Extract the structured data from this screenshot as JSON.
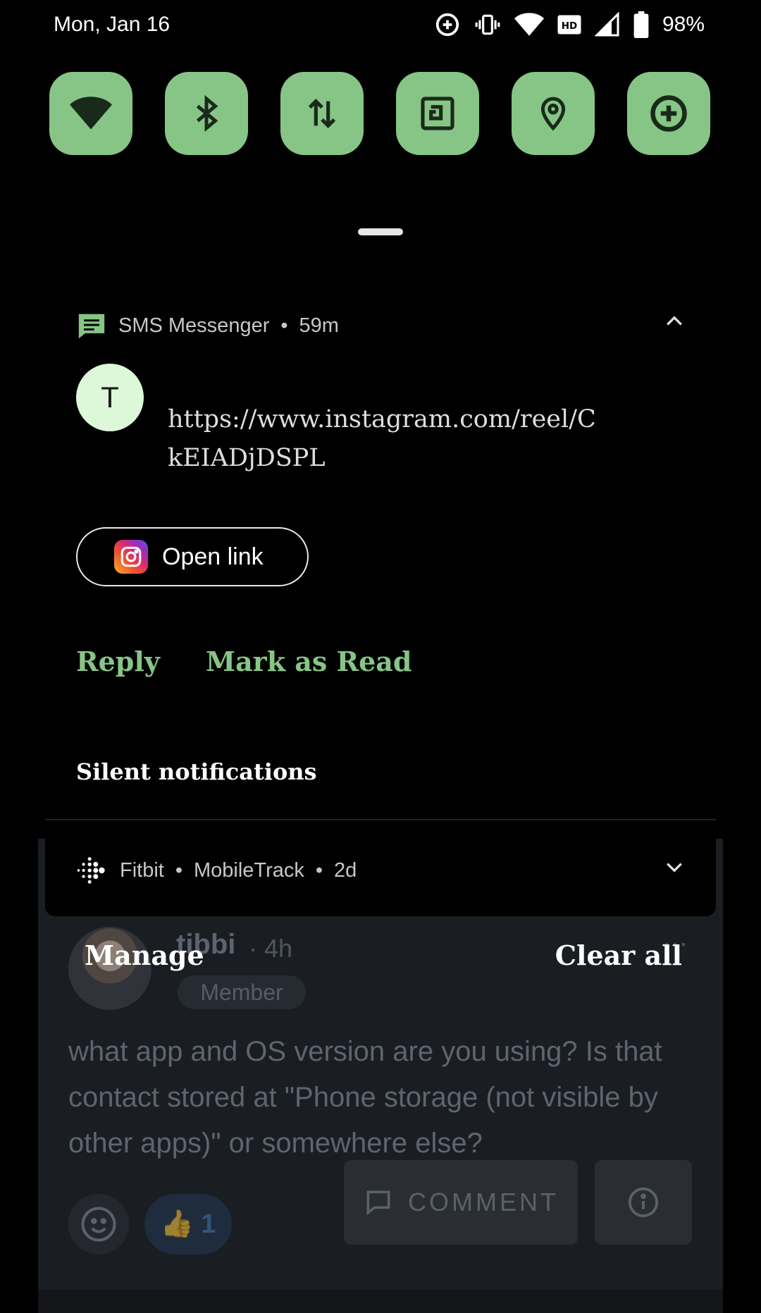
{
  "status_bar": {
    "date": "Mon, Jan 16",
    "battery": "98%",
    "icons": [
      "data-saver-icon",
      "vibrate-icon",
      "wifi-icon",
      "hd-icon",
      "signal-icon",
      "battery-icon"
    ]
  },
  "quick_settings": {
    "accent": "#86c586",
    "tiles": [
      "wifi-icon",
      "bluetooth-icon",
      "mobile-data-icon",
      "nfc-icon",
      "location-icon",
      "data-saver-icon"
    ]
  },
  "notification": {
    "app": "SMS Messenger",
    "time": "59m",
    "sender_initial": "T",
    "message": "https://www.instagram.com/reel/CkEIADjDSPL",
    "open_link": "Open link",
    "actions": {
      "reply": "Reply",
      "mark_read": "Mark as Read"
    }
  },
  "silent": {
    "title": "Silent notifications",
    "item": {
      "app": "Fitbit",
      "channel": "MobileTrack",
      "time": "2d"
    }
  },
  "footer": {
    "manage": "Manage",
    "clear_all": "Clear all"
  },
  "background": {
    "author": "tibbi",
    "time": "· 4h",
    "badge": "Member",
    "body": "what app and OS version are you using? Is that contact stored at \"Phone storage (not visible by other apps)\" or somewhere else?",
    "like_count": "1",
    "comment_label": "COMMENT"
  }
}
